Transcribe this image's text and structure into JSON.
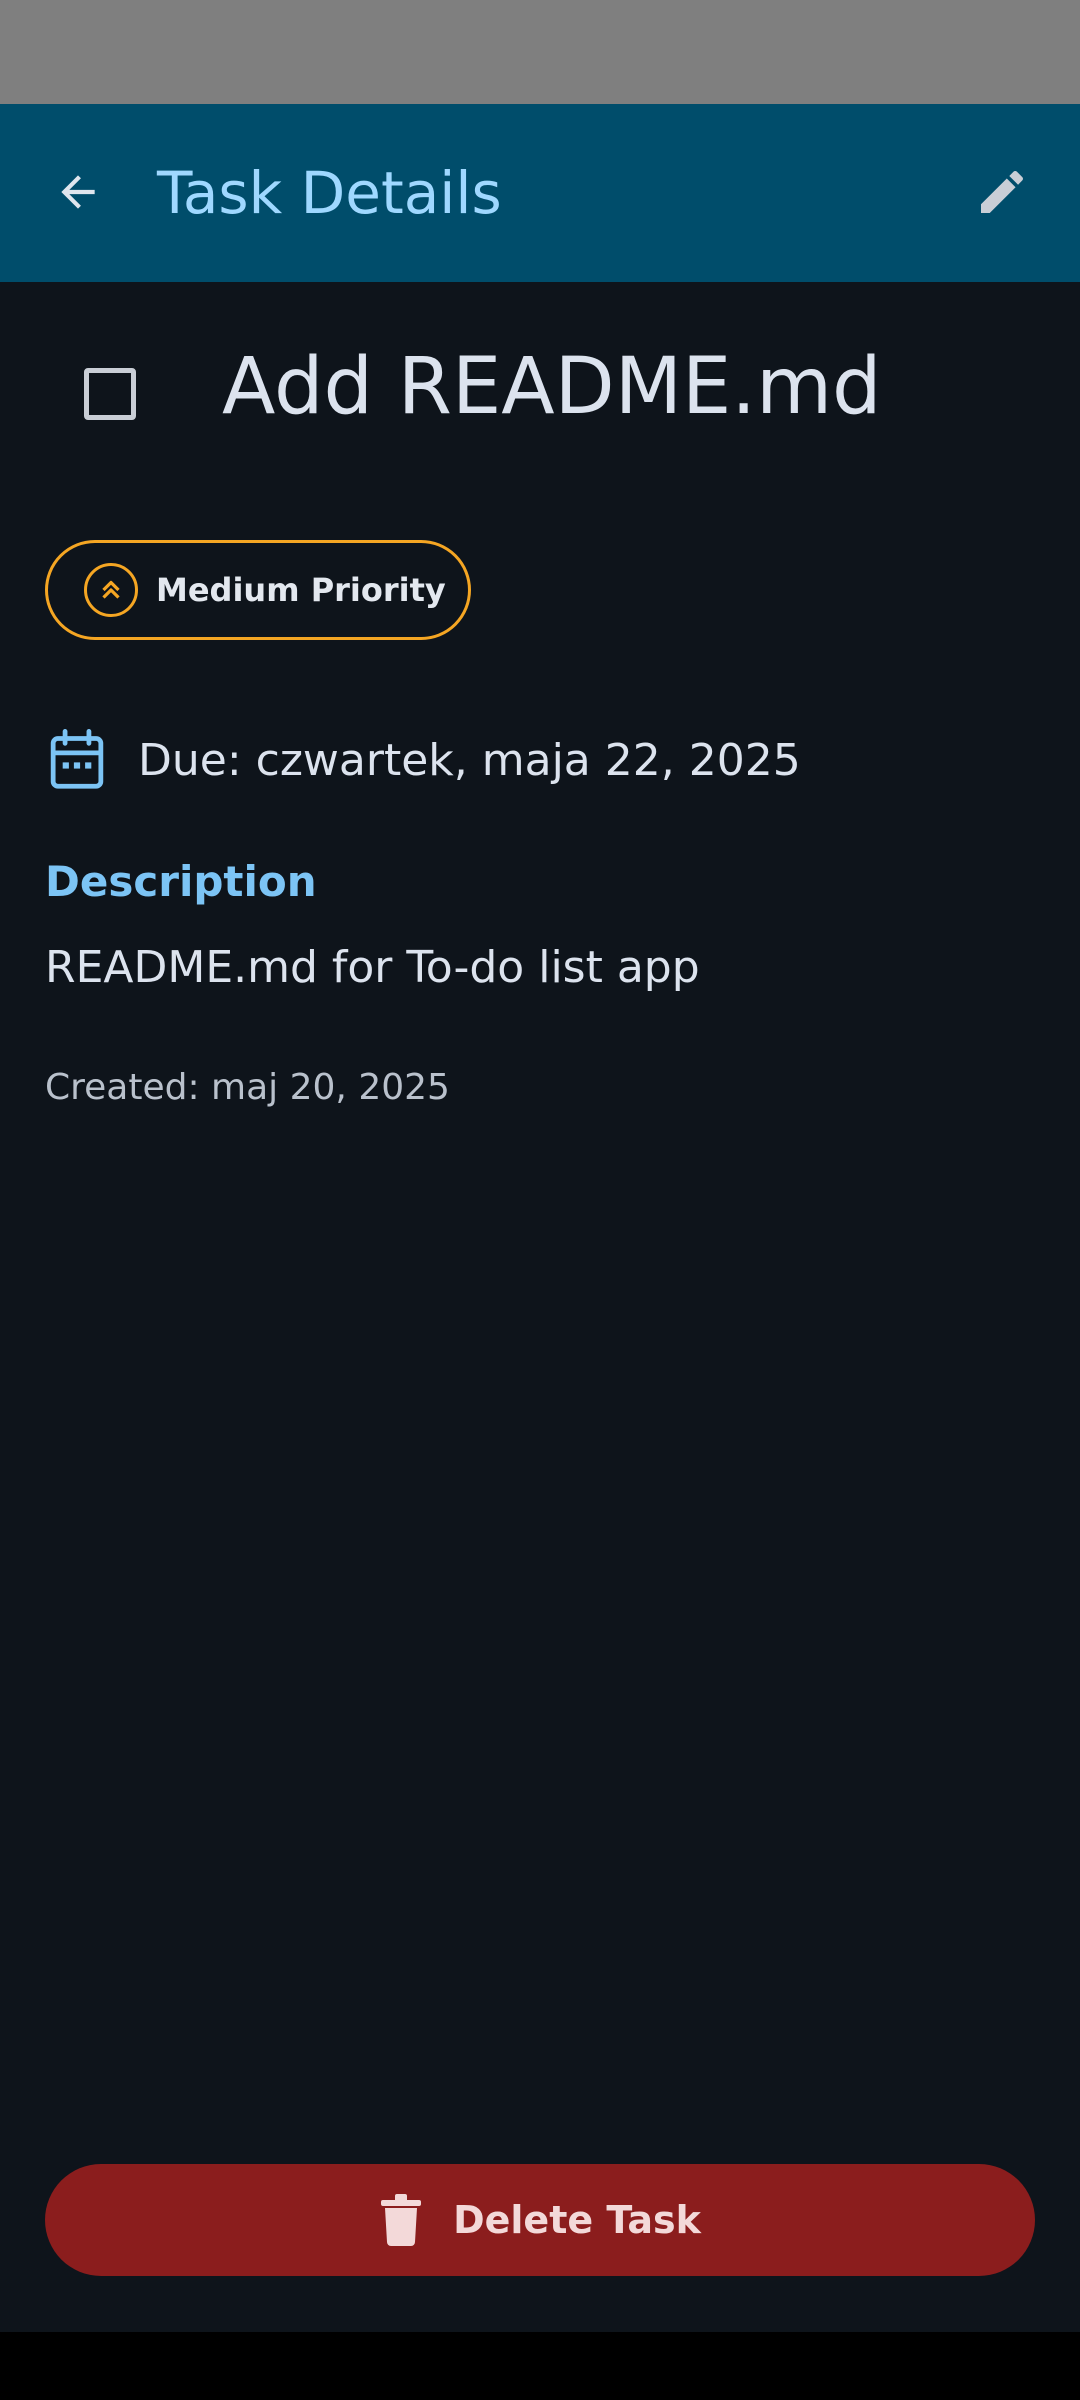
{
  "app_bar": {
    "title": "Task Details",
    "back_icon": "arrow-back-icon",
    "edit_icon": "pencil-icon"
  },
  "task": {
    "title": "Add README.md",
    "completed": false,
    "priority_label": "Medium Priority",
    "priority_icon": "chevron-double-up-icon",
    "due_text": "Due: czwartek, maja 22, 2025",
    "due_icon": "calendar-icon",
    "description_heading": "Description",
    "description": "README.md for To-do list app",
    "created_text": "Created: maj 20, 2025"
  },
  "actions": {
    "delete_label": "Delete Task",
    "delete_icon": "trash-icon"
  },
  "colors": {
    "status_bar": "#7f7f7f",
    "app_bar": "#004d6b",
    "title_text": "#9fd8ff",
    "background": "#0e141b",
    "priority_accent": "#f5a623",
    "description_heading": "#7cc4f5",
    "delete_button": "#8b1d1d"
  }
}
